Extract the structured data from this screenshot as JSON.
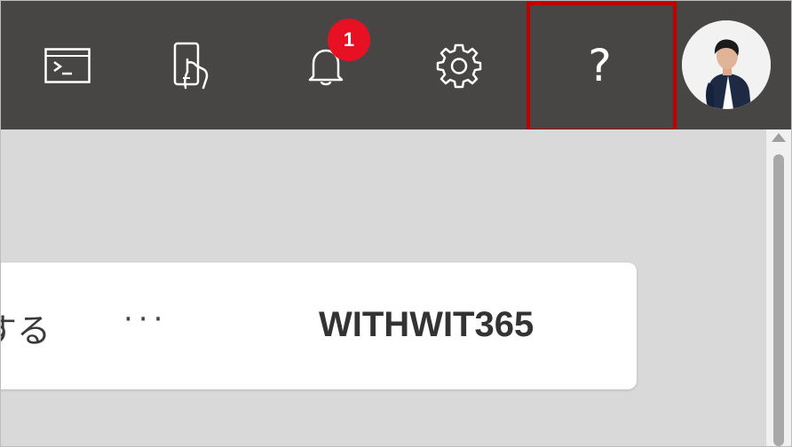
{
  "topbar": {
    "icons": {
      "cloud_shell": "cloud-shell-icon",
      "directory": "directory-subscription-icon",
      "notifications": "bell-icon",
      "settings": "gear-icon",
      "help": "help-icon",
      "avatar": "user-avatar"
    },
    "notification_count": "1",
    "help_glyph": "?",
    "colors": {
      "bar": "#484644",
      "badge": "#e81123",
      "highlight": "#c00000"
    }
  },
  "card": {
    "action_text": "する",
    "more_label": "···",
    "org_name": "WITHWIT365"
  }
}
